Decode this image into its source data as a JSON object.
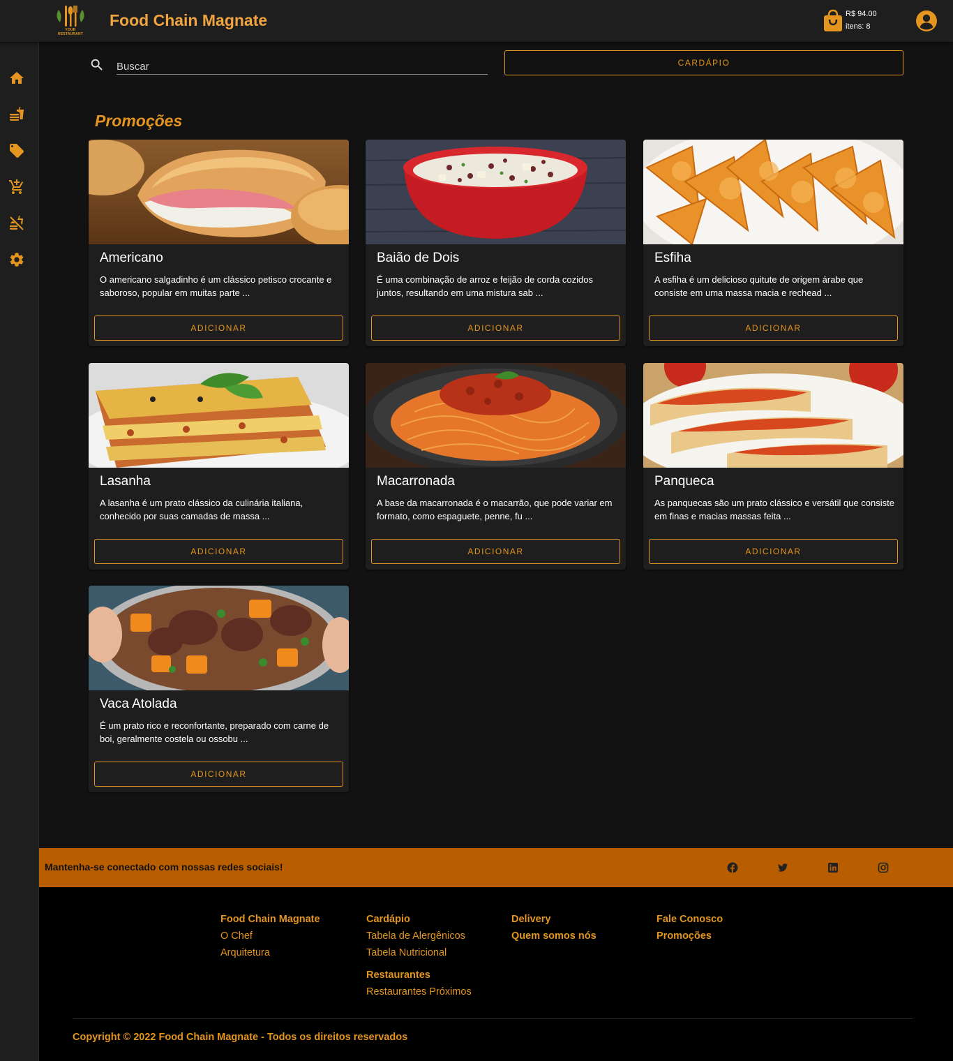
{
  "header": {
    "logo_text": "YOUR RESTAURANT",
    "title": "Food Chain Magnate",
    "cart_total": "R$ 94.00",
    "cart_items": "itens: 8"
  },
  "sidebar": {
    "items": [
      {
        "icon": "home-icon"
      },
      {
        "icon": "fastfood-icon"
      },
      {
        "icon": "tag-icon"
      },
      {
        "icon": "cart-icon"
      },
      {
        "icon": "no-food-icon"
      },
      {
        "icon": "settings-icon"
      }
    ]
  },
  "search": {
    "placeholder": "Buscar"
  },
  "menu_button": "CARDÁPIO",
  "section_title": "Promoções",
  "products": [
    {
      "name": "Americano",
      "description": "O americano salgadinho é um clássico petisco crocante e saboroso, popular em muitas parte ...",
      "button": "ADICIONAR",
      "image": "pastry-with-ham"
    },
    {
      "name": "Baião de Dois",
      "description": "É uma combinação de arroz e feijão de corda cozidos juntos, resultando em uma mistura sab ...",
      "button": "ADICIONAR",
      "image": "rice-bowl"
    },
    {
      "name": "Esfiha",
      "description": "A esfiha é um delicioso quitute de origem árabe que consiste em uma massa macia e rechead ...",
      "button": "ADICIONAR",
      "image": "esfiha-plate"
    },
    {
      "name": "Lasanha",
      "description": "A lasanha é um prato clássico da culinária italiana, conhecido por suas camadas de massa ...",
      "button": "ADICIONAR",
      "image": "lasagna"
    },
    {
      "name": "Macarronada",
      "description": "A base da macarronada é o macarrão, que pode variar em formato, como espaguete, penne, fu ...",
      "button": "ADICIONAR",
      "image": "spaghetti"
    },
    {
      "name": "Panqueca",
      "description": "As panquecas são um prato clássico e versátil que consiste em finas e macias massas feita ...",
      "button": "ADICIONAR",
      "image": "pancakes"
    },
    {
      "name": "Vaca Atolada",
      "description": "É um prato rico e reconfortante, preparado com carne de boi, geralmente costela ou ossobu ...",
      "button": "ADICIONAR",
      "image": "beef-stew"
    }
  ],
  "social": {
    "text": "Mantenha-se conectado com nossas redes sociais!",
    "icons": [
      "facebook-icon",
      "twitter-icon",
      "linkedin-icon",
      "instagram-icon"
    ]
  },
  "footer": {
    "col1": {
      "title": "Food Chain Magnate",
      "links": [
        "O Chef",
        "Arquitetura"
      ]
    },
    "col2": {
      "title": "Cardápio",
      "links": [
        "Tabela de Alergênicos",
        "Tabela Nutricional"
      ],
      "title2": "Restaurantes",
      "links2": [
        "Restaurantes Próximos"
      ]
    },
    "col3": {
      "links": [
        "Delivery",
        "Quem somos nós"
      ]
    },
    "col4": {
      "links": [
        "Fale Conosco",
        "Promoções"
      ]
    },
    "copyright": "Copyright © 2022 Food Chain Magnate - Todos os direitos reservados"
  },
  "colors": {
    "accent": "#e3951f",
    "title": "#f0a341",
    "social_bar": "#b85e00",
    "background": "#121212",
    "surface": "#1e1e1e"
  }
}
